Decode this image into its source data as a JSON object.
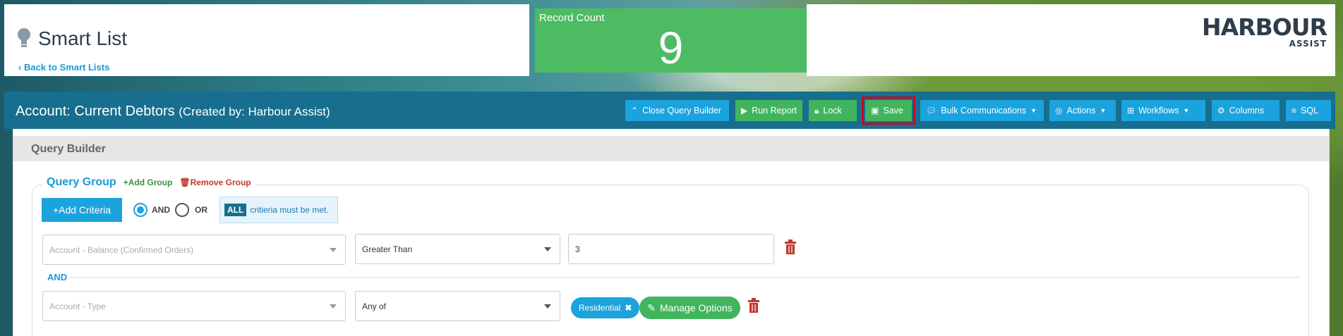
{
  "header": {
    "title": "Smart List",
    "back_link": "Back to Smart Lists",
    "record_count_label": "Record Count",
    "record_count_value": "9",
    "logo_line1": "HARBOUR",
    "logo_line2": "ASSIST"
  },
  "titlebar": {
    "title": "Account: Current Debtors",
    "subtitle": "(Created by: Harbour Assist)"
  },
  "toolbar": {
    "close_query_builder": "Close Query Builder",
    "run_report": "Run Report",
    "lock": "Lock",
    "save": "Save",
    "bulk_communications": "Bulk Communications",
    "actions": "Actions",
    "workflows": "Workflows",
    "columns": "Columns",
    "sql": "SQL"
  },
  "query_builder": {
    "heading": "Query Builder",
    "group_title": "Query Group",
    "add_group": "Add Group",
    "remove_group": "Remove Group",
    "add_criteria": "Add Criteria",
    "and_label": "AND",
    "or_label": "OR",
    "logic_selected": "AND",
    "all_badge": "ALL",
    "criteria_note": "critieria must be met.",
    "rows": [
      {
        "field_placeholder": "Account - Balance (Confirmed Orders)",
        "operator": "Greater Than",
        "value": "3"
      },
      {
        "field_placeholder": "Account - Type",
        "operator": "Any of",
        "value_pill": "Residential",
        "manage_options": "Manage Options"
      }
    ],
    "separator": "AND"
  },
  "colors": {
    "brand_blue": "#176e8f",
    "accent_blue": "#1ba3dd",
    "green": "#41b55d",
    "record_green": "#4dbb62",
    "danger": "#c0392b",
    "save_highlight": "#d0021b"
  }
}
